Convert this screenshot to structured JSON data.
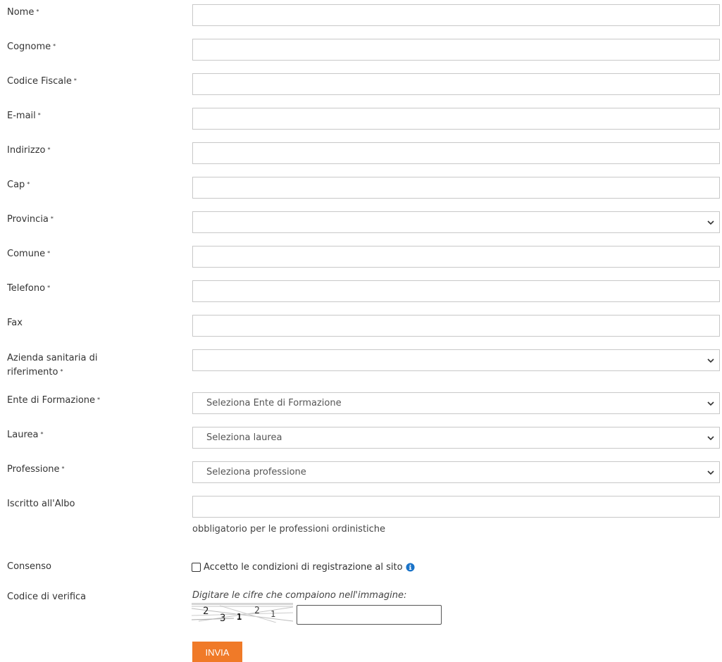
{
  "form": {
    "required_mark": "*",
    "fields": [
      {
        "label": "Nome",
        "required": true,
        "type": "text",
        "value": ""
      },
      {
        "label": "Cognome",
        "required": true,
        "type": "text",
        "value": ""
      },
      {
        "label": "Codice Fiscale",
        "required": true,
        "type": "text",
        "value": ""
      },
      {
        "label": "E-mail",
        "required": true,
        "type": "text",
        "value": ""
      },
      {
        "label": "Indirizzo",
        "required": true,
        "type": "text",
        "value": ""
      },
      {
        "label": "Cap",
        "required": true,
        "type": "text",
        "value": ""
      },
      {
        "label": "Provincia",
        "required": true,
        "type": "select",
        "value": ""
      },
      {
        "label": "Comune",
        "required": true,
        "type": "text",
        "value": ""
      },
      {
        "label": "Telefono",
        "required": true,
        "type": "text",
        "value": ""
      },
      {
        "label": "Fax",
        "required": false,
        "type": "text",
        "value": ""
      },
      {
        "label": "Azienda sanitaria di riferimento",
        "required": true,
        "type": "select",
        "value": ""
      },
      {
        "label": "Ente di Formazione",
        "required": true,
        "type": "select",
        "value": "Seleziona Ente di Formazione"
      },
      {
        "label": "Laurea",
        "required": true,
        "type": "select",
        "value": "Seleziona laurea"
      },
      {
        "label": "Professione",
        "required": true,
        "type": "select",
        "value": "Seleziona professione"
      },
      {
        "label": "Iscritto all'Albo",
        "required": false,
        "type": "text",
        "value": ""
      }
    ],
    "albo_hint": "obbligatorio per le professioni ordinistiche",
    "consent": {
      "label": "Consenso",
      "checkbox_text": "Accetto le condizioni di registrazione al sito",
      "checked": false,
      "info_icon": "info-circle-icon"
    },
    "captcha": {
      "label": "Codice di verifica",
      "instruction": "Digitare le cifre che compaiono nell'immagine:",
      "digits": [
        "2",
        "3",
        "1",
        "2",
        "1"
      ],
      "value": ""
    },
    "submit_label": "INVIA"
  },
  "colors": {
    "accent": "#f07a28",
    "info": "#1a73c8",
    "border": "#c8c8c8"
  }
}
